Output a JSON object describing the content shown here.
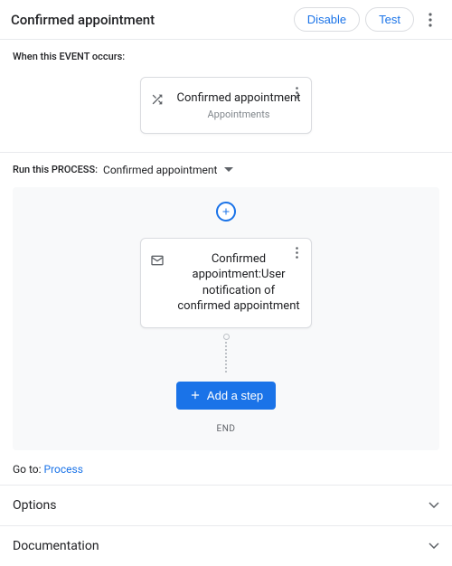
{
  "header": {
    "title": "Confirmed appointment",
    "disable": "Disable",
    "test": "Test"
  },
  "event": {
    "section_label": "When this EVENT occurs:",
    "card_title": "Confirmed appointment",
    "card_sub": "Appointments"
  },
  "process": {
    "label": "Run this PROCESS:",
    "selected": "Confirmed appointment"
  },
  "step": {
    "title": "Confirmed appointment:User notification of confirmed appointment"
  },
  "add_step": "Add a step",
  "end": "END",
  "goto": {
    "prefix": "Go to: ",
    "link": "Process"
  },
  "accordion": {
    "options": "Options",
    "documentation": "Documentation"
  }
}
